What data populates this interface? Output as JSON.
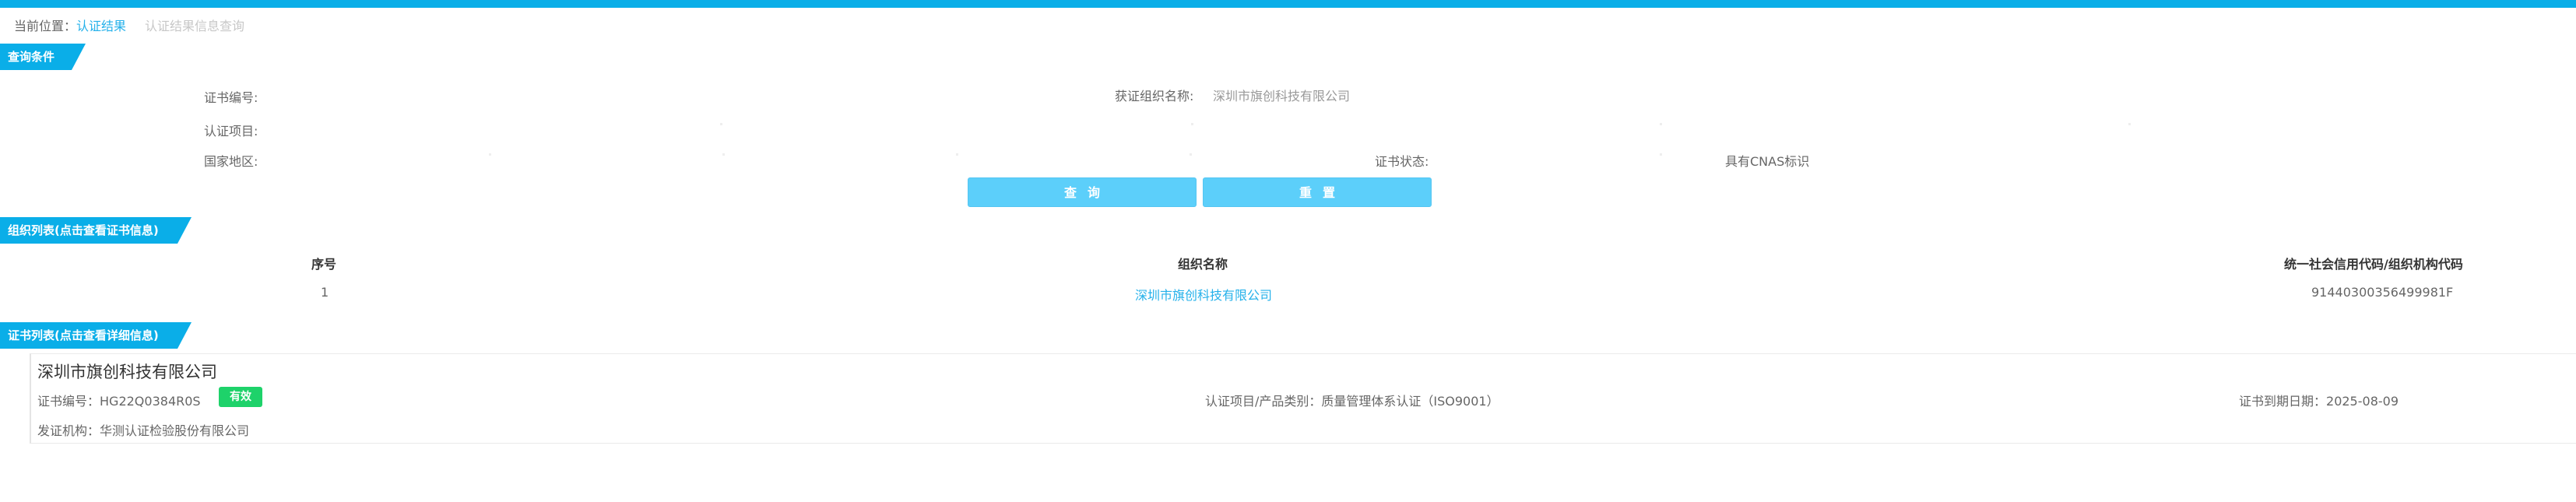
{
  "breadcrumb": {
    "prefix": "当前位置：",
    "current": "认证结果",
    "next": "认证结果信息查询"
  },
  "query": {
    "section_title": "查询条件",
    "cert_no_label": "证书编号:",
    "org_name_label": "获证组织名称:",
    "org_name_value": "深圳市旗创科技有限公司",
    "project_label": "认证项目:",
    "region_label": "国家地区:",
    "status_label": "证书状态:",
    "cnas_label": "具有CNAS标识",
    "search_button": "查询",
    "reset_button": "重置"
  },
  "org_list": {
    "section_title": "组织列表(点击查看证书信息)",
    "columns": [
      "序号",
      "组织名称",
      "统一社会信用代码/组织机构代码"
    ],
    "rows": [
      {
        "index": "1",
        "name": "深圳市旗创科技有限公司",
        "code": "91440300356499981F"
      }
    ]
  },
  "cert_list": {
    "section_title": "证书列表(点击查看详细信息)",
    "items": [
      {
        "org_name": "深圳市旗创科技有限公司",
        "cert_no_label": "证书编号：",
        "cert_no": "HG22Q0384R0S",
        "status_badge": "有效",
        "project_label": "认证项目/产品类别：",
        "project": "质量管理体系认证（ISO9001）",
        "expiry_label": "证书到期日期：",
        "expiry": "2025-08-09",
        "issuer_label": "发证机构：",
        "issuer": "华测认证检验股份有限公司"
      }
    ]
  },
  "colors": {
    "accent": "#0aaee8",
    "button": "#5ccffa",
    "link": "#25b1ea",
    "valid_badge": "#1ed26a"
  }
}
